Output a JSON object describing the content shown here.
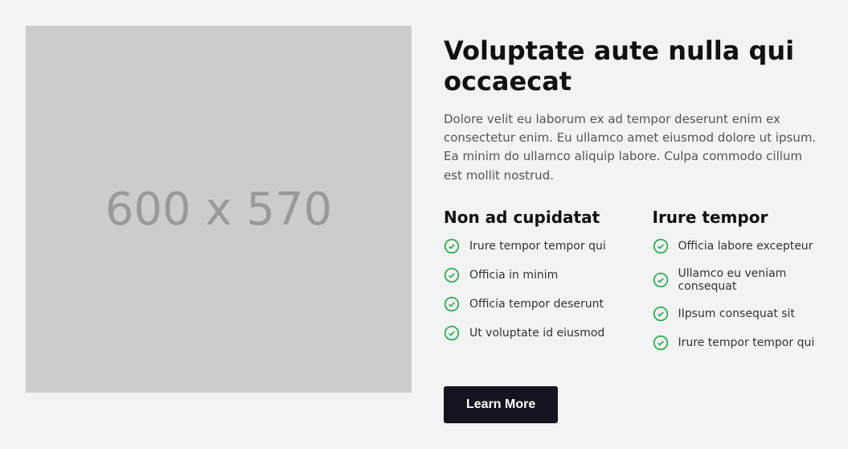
{
  "image": {
    "placeholder_text": "600 x 570"
  },
  "heading": "Voluptate aute nulla qui occaecat",
  "description": "Dolore velit eu laborum ex ad tempor deserunt enim ex consectetur enim. Eu ullamco amet eiusmod dolore ut ipsum. Ea minim do ullamco aliquip labore. Culpa commodo cillum est mollit nostrud.",
  "columns": [
    {
      "heading": "Non ad cupidatat",
      "items": [
        "Irure tempor tempor qui",
        "Officia in minim",
        "Officia tempor deserunt",
        "Ut voluptate id eiusmod"
      ]
    },
    {
      "heading": "Irure tempor",
      "items": [
        "Officia labore excepteur",
        "Ullamco eu veniam consequat",
        "IIpsum consequat sit",
        "Irure tempor tempor qui"
      ]
    }
  ],
  "button": {
    "label": "Learn More"
  },
  "colors": {
    "check_icon": "#2ba745"
  }
}
